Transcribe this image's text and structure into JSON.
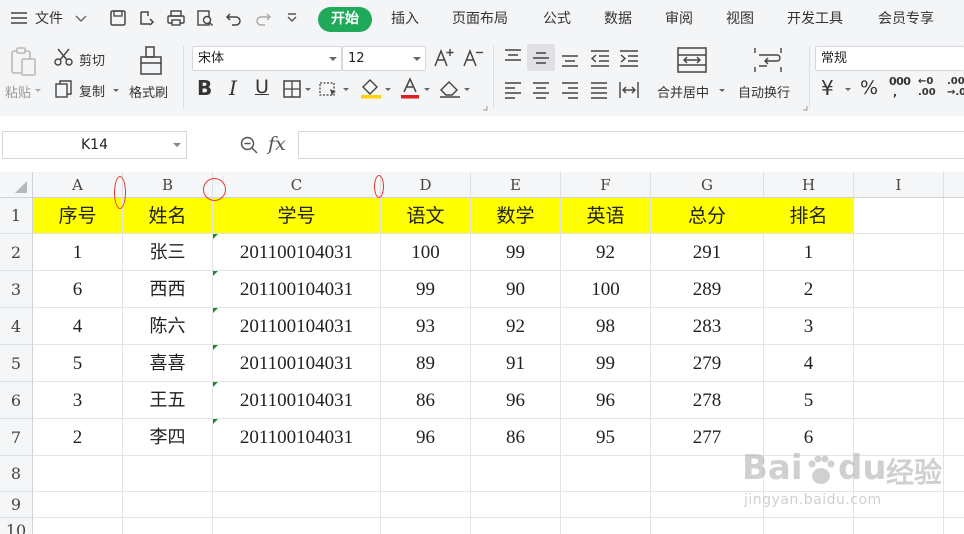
{
  "menu": {
    "file": "文件",
    "tabs": [
      "开始",
      "插入",
      "页面布局",
      "公式",
      "数据",
      "审阅",
      "视图",
      "开发工具",
      "会员专享"
    ]
  },
  "toolbar": {
    "paste": "粘贴",
    "cut": "剪切",
    "copy": "复制",
    "format_painter": "格式刷",
    "font_name": "宋体",
    "font_size": "12",
    "merge_center": "合并居中",
    "wrap_text": "自动换行",
    "number_format": "常规",
    "percent": "%",
    "thousands": "000",
    "dec_inc_top": "←0",
    "dec_inc_bottom": ".00",
    "dec_dec_top": ".00",
    "dec_dec_bottom": "→.0",
    "currency": "¥",
    "bold": "B",
    "italic": "I",
    "underline": "U"
  },
  "formula_bar": {
    "name_box": "K14",
    "fx": "fx",
    "content": ""
  },
  "sheet": {
    "columns": [
      "A",
      "B",
      "C",
      "D",
      "E",
      "F",
      "G",
      "H",
      "I"
    ],
    "rows": [
      "1",
      "2",
      "3",
      "4",
      "5",
      "6",
      "7",
      "8",
      "9",
      "10"
    ],
    "header": [
      "序号",
      "姓名",
      "学号",
      "语文",
      "数学",
      "英语",
      "总分",
      "排名"
    ],
    "data": [
      [
        "1",
        "张三",
        "201100104031",
        "100",
        "99",
        "92",
        "291",
        "1"
      ],
      [
        "6",
        "西西",
        "201100104031",
        "99",
        "90",
        "100",
        "289",
        "2"
      ],
      [
        "4",
        "陈六",
        "201100104031",
        "93",
        "92",
        "98",
        "283",
        "3"
      ],
      [
        "5",
        "喜喜",
        "201100104031",
        "89",
        "91",
        "99",
        "279",
        "4"
      ],
      [
        "3",
        "王五",
        "201100104031",
        "86",
        "96",
        "96",
        "278",
        "5"
      ],
      [
        "2",
        "李四",
        "201100104031",
        "96",
        "86",
        "95",
        "277",
        "6"
      ]
    ]
  },
  "watermark": {
    "brand": "Bai",
    "brand2": "du",
    "cn": "经验",
    "url": "jingyan.baidu.com"
  },
  "colors": {
    "accent": "#1faa5a",
    "header_fill": "#ffff00",
    "annotation": "#e53935"
  }
}
